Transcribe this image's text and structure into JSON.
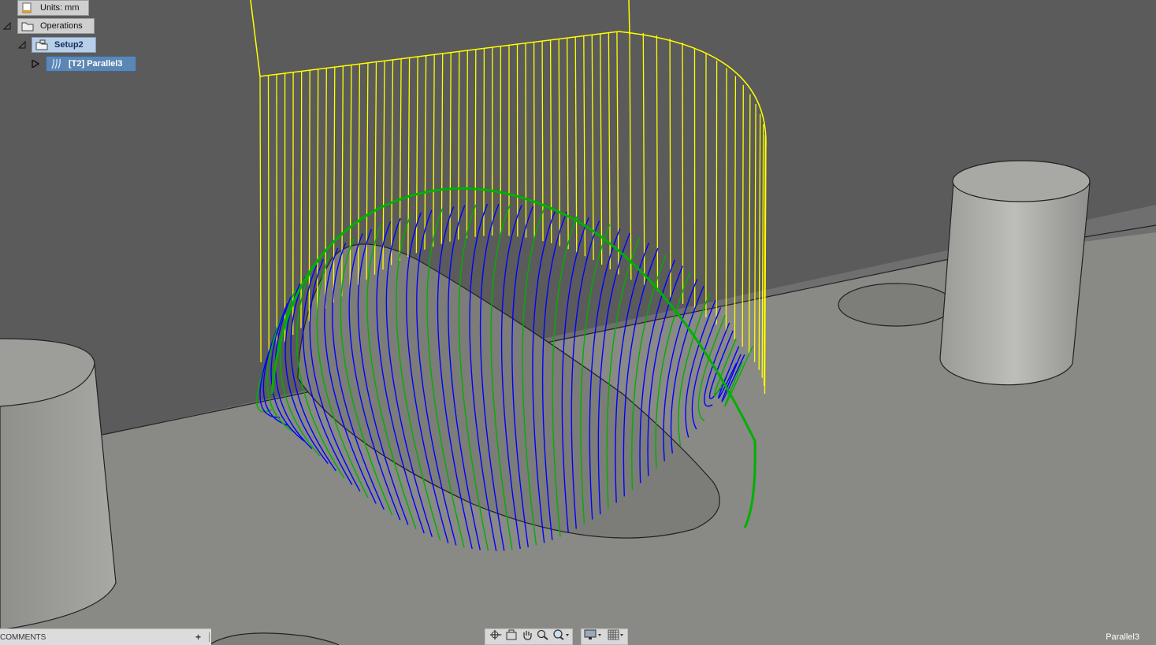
{
  "browser": {
    "units_label": "Units: mm",
    "operations_label": "Operations",
    "setup_label": "Setup2",
    "operation_label": "[T2] Parallel3"
  },
  "comments": {
    "label": "COMMENTS",
    "add_symbol": "+"
  },
  "status": {
    "operation_name": "Parallel3"
  },
  "colors": {
    "background": "#6f6f6f",
    "wall": "#5b5b5b",
    "floor": "#8a8a87",
    "rapid_moves": "#ffff00",
    "cutting_moves": "#0000ff",
    "lead_moves": "#00b000",
    "selected_operation": "#5c86b3"
  },
  "icons": [
    "document-icon",
    "operations-folder-icon",
    "setup-icon",
    "parallel-toolpath-icon",
    "orbit-icon",
    "look-at-icon",
    "pan-icon",
    "zoom-icon",
    "zoom-window-icon",
    "display-settings-icon",
    "grid-icon"
  ]
}
